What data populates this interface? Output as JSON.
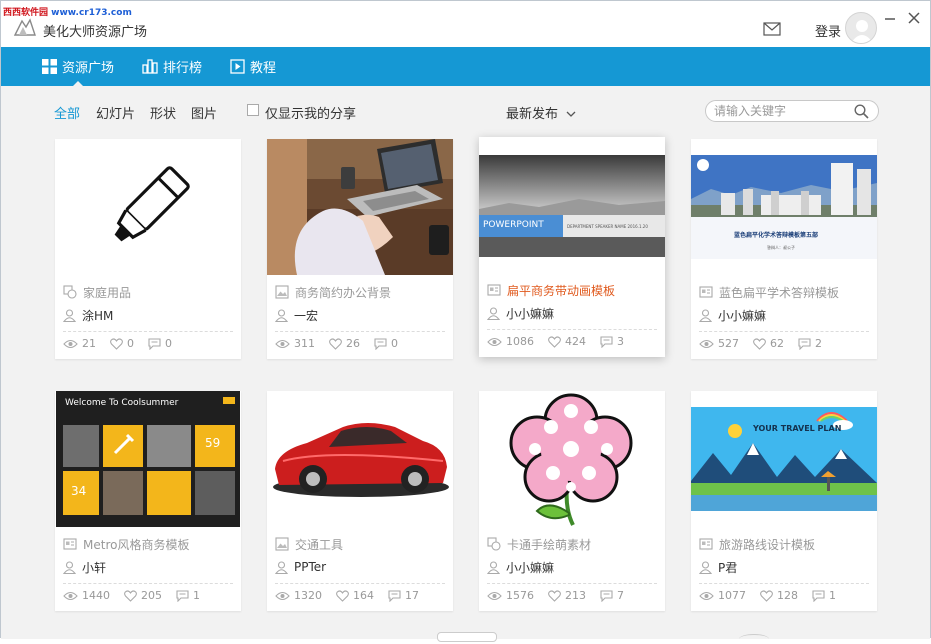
{
  "watermark": {
    "left": "西西软件园",
    "right": "www.cr173.com"
  },
  "app": {
    "title": "美化大师资源广场",
    "login_label": "登录"
  },
  "nav": {
    "tabs": [
      {
        "label": "资源广场",
        "icon": "grid-icon"
      },
      {
        "label": "排行榜",
        "icon": "ranking-icon"
      },
      {
        "label": "教程",
        "icon": "play-icon"
      }
    ]
  },
  "filters": {
    "items": [
      "全部",
      "幻灯片",
      "形状",
      "图片"
    ],
    "only_mine": "仅显示我的分享",
    "sort": "最新发布"
  },
  "search": {
    "placeholder": "请输入关键字",
    "value": ""
  },
  "cards": [
    {
      "category": "家庭用品",
      "type_icon": "shape-icon",
      "author": "涂HM",
      "views": "21",
      "likes": "0",
      "comments": "0"
    },
    {
      "category": "商务简约办公背景",
      "type_icon": "image-icon",
      "author": "一宏",
      "views": "311",
      "likes": "26",
      "comments": "0"
    },
    {
      "category": "扁平商务带动画模板",
      "type_icon": "slide-icon",
      "author": "小小嫲嫲",
      "views": "1086",
      "likes": "424",
      "comments": "3"
    },
    {
      "category": "蓝色扁平学术答辩模板",
      "type_icon": "slide-icon",
      "author": "小小嫲嫲",
      "views": "527",
      "likes": "62",
      "comments": "2"
    },
    {
      "category": "Metro风格商务模板",
      "type_icon": "slide-icon",
      "author": "小轩",
      "views": "1440",
      "likes": "205",
      "comments": "1"
    },
    {
      "category": "交通工具",
      "type_icon": "image-icon",
      "author": "PPTer",
      "views": "1320",
      "likes": "164",
      "comments": "17"
    },
    {
      "category": "卡通手绘萌素材",
      "type_icon": "shape-icon",
      "author": "小小嫲嫲",
      "views": "1576",
      "likes": "213",
      "comments": "7"
    },
    {
      "category": "旅游路线设计模板",
      "type_icon": "slide-icon",
      "author": "P君",
      "views": "1077",
      "likes": "128",
      "comments": "1"
    }
  ],
  "thumbs": {
    "ppt_main": "POWERPOINT",
    "ppt_sub": "DEPARTMENT SPEAKER NAME 2016.1.20",
    "defense_title": "蓝色扁平化学术答辩模板第五部",
    "defense_sub": "答辩人：叔公子",
    "metro_title": "Welcome To Coolsummer",
    "metro_n1": "59",
    "metro_n2": "34",
    "travel_title": "YOUR TRAVEL PLAN"
  },
  "colors": {
    "accent": "#1598d4",
    "highlight": "#e05a1e",
    "background": "#f2f2f2"
  }
}
